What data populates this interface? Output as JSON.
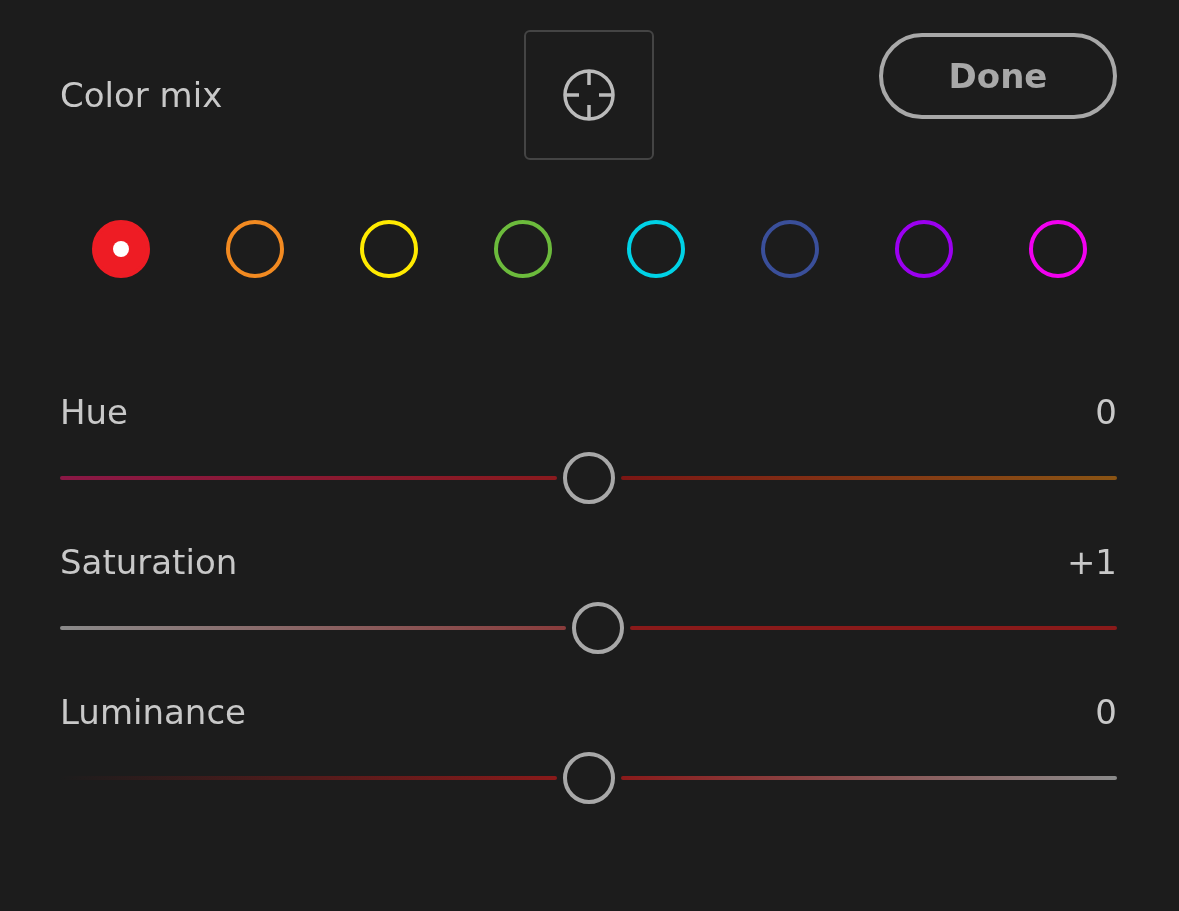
{
  "header": {
    "title": "Color mix",
    "done_button": "Done"
  },
  "colors": [
    {
      "color": "#ee1c24",
      "selected": true
    },
    {
      "color": "#f28a21",
      "selected": false
    },
    {
      "color": "#ffea00",
      "selected": false
    },
    {
      "color": "#6cbb3c",
      "selected": false
    },
    {
      "color": "#00d2e6",
      "selected": false
    },
    {
      "color": "#3a4f9a",
      "selected": false
    },
    {
      "color": "#9b00f0",
      "selected": false
    },
    {
      "color": "#f200f0",
      "selected": false
    }
  ],
  "sliders": [
    {
      "label": "Hue",
      "kind": "hue",
      "value": "0",
      "level": 0.5
    },
    {
      "label": "Saturation",
      "kind": "saturation",
      "value": "+1",
      "level": 0.51
    },
    {
      "label": "Luminance",
      "kind": "luminance",
      "value": "0",
      "level": 0.5
    }
  ]
}
